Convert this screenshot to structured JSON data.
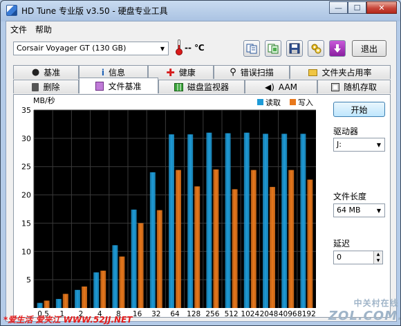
{
  "window": {
    "title": "HD Tune 专业版 v3.50 - 硬盘专业工具",
    "minimize": "—",
    "maximize": "☐",
    "close": "✕"
  },
  "menu": [
    "文件",
    "帮助"
  ],
  "toolbar": {
    "drive": "Corsair Voyager GT (130 GB)",
    "temperature": "-- ℃",
    "exit_label": "退出",
    "icons": [
      "copy-text-icon",
      "copy-screenshot-icon",
      "save-icon",
      "options-icon",
      "down-arrow-icon"
    ]
  },
  "tabs_row1": [
    "基准",
    "信息",
    "健康",
    "错误扫描",
    "文件夹占用率"
  ],
  "tabs_row2": [
    "删除",
    "文件基准",
    "磁盘监视器",
    "AAM",
    "随机存取"
  ],
  "active_tab": "文件基准",
  "side": {
    "start_label": "开始",
    "drive_label": "驱动器",
    "drive_value": "J:",
    "length_label": "文件长度",
    "length_value": "64 MB",
    "delay_label": "延迟",
    "delay_value": "0"
  },
  "chart_data": {
    "type": "bar",
    "ylabel": "MB/秒",
    "ylim": [
      0,
      35
    ],
    "yticks": [
      5,
      10,
      15,
      20,
      25,
      30,
      35
    ],
    "categories": [
      "0.5",
      "1",
      "2",
      "4",
      "8",
      "16",
      "32",
      "64",
      "128",
      "256",
      "512",
      "1024",
      "2048",
      "4096",
      "8192"
    ],
    "series": [
      {
        "name": "读取",
        "color": "#1e9bd7",
        "values": [
          0.9,
          1.6,
          3.2,
          6.3,
          11.1,
          17.4,
          24.0,
          30.7,
          30.7,
          31.0,
          30.9,
          31.0,
          30.8,
          30.8,
          30.8
        ]
      },
      {
        "name": "写入",
        "color": "#e8781c",
        "values": [
          1.3,
          2.5,
          3.8,
          6.6,
          9.1,
          15.0,
          17.3,
          24.4,
          21.5,
          24.5,
          21.0,
          24.4,
          21.4,
          24.4,
          22.7
        ]
      }
    ],
    "grid": true,
    "legend": "top-right"
  },
  "watermarks": {
    "left": "*爱生活 爱夹江 WWW.52JJ.NET",
    "right_top": "中关村在线",
    "right_bottom": "ZOL.COM.CN"
  }
}
